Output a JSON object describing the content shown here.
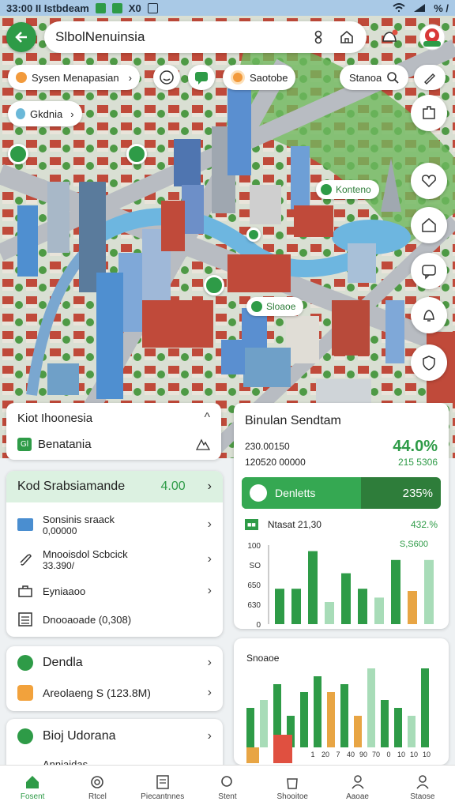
{
  "status": {
    "time": "33:00 II Istbdeam",
    "icons": [
      "X0"
    ],
    "right": "% /"
  },
  "search": {
    "title": "SlbolNenuinsia"
  },
  "chips": [
    "Sysen Menapasian",
    "Saotobe",
    "Stanoa",
    "Gkdnia"
  ],
  "map_labels": [
    "Konteno",
    "Sloaoe"
  ],
  "region_card": {
    "title": "Kiot Ihoonesia",
    "subtitle": "Benatania",
    "icon_letter": "Gl"
  },
  "list_card": {
    "header": "Kod Srabsiamande",
    "header_value": "4.00",
    "items": [
      {
        "l1": "Sonsinis sraack",
        "l2": "0,00000"
      },
      {
        "l1": "Mnooisdol Scbcick",
        "l2": "33.390/"
      },
      {
        "l1": "Eyniaaoo",
        "l2": ""
      },
      {
        "l1": "Dnooaoade (0,308)",
        "l2": ""
      }
    ]
  },
  "card2": {
    "items": [
      "Dendla",
      "Areolaeng S (123.8M)"
    ]
  },
  "card3": {
    "items": [
      "Bioj Udorana",
      "Anniaidas"
    ]
  },
  "stats": {
    "title": "Binulan Sendtam",
    "line1": "230.00150",
    "line1_value": "44.0%",
    "line2": "120520 00000",
    "line2_value": "215 5306",
    "progress_label": "Denletts",
    "progress_value": "235%",
    "progress": 0.6,
    "sub_left": "Ntasat 21,30",
    "sub_right": "432.%",
    "bar_label": "S,S600"
  },
  "chart_data": [
    {
      "type": "bar",
      "yticks": [
        "100",
        "SO",
        "650",
        "630",
        "0"
      ],
      "series": [
        {
          "values": [
            32,
            32,
            66,
            14,
            46,
            32,
            0,
            58,
            18,
            0
          ]
        },
        {
          "values": [
            0,
            0,
            0,
            20,
            0,
            0,
            24,
            0,
            30,
            58
          ]
        }
      ]
    },
    {
      "type": "bar",
      "title": "Snoaoe",
      "xticks": [
        "1",
        "20",
        "7",
        "40",
        "90",
        "70",
        "0",
        "10",
        "10",
        "10"
      ]
    }
  ],
  "nav": [
    "Fosent",
    "Rtcel",
    "Piecantnnes",
    "Stent",
    "Shooitoe",
    "Aaoae",
    "Staose"
  ],
  "colors": {
    "accent": "#2e9b47",
    "accent_light": "#a8dcb8",
    "orange": "#e8a544",
    "red": "#e05040"
  }
}
